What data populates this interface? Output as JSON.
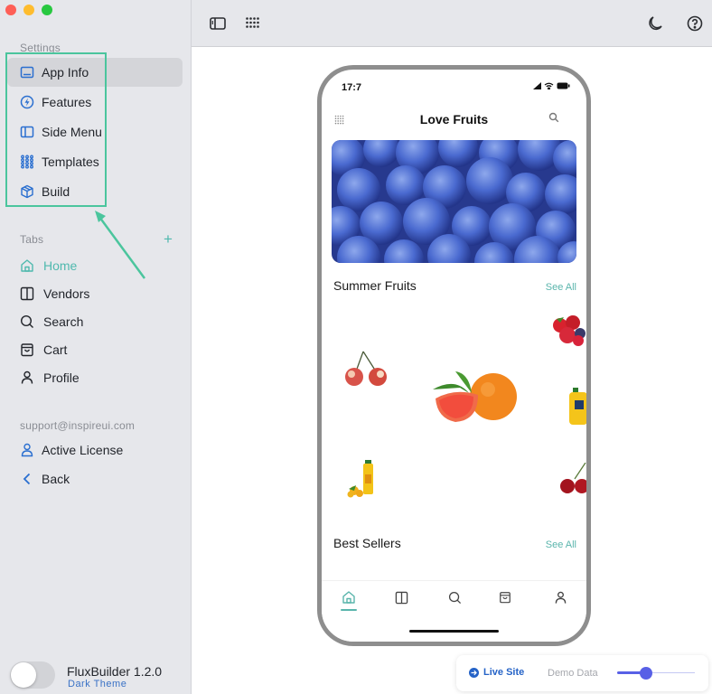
{
  "window": {
    "controls": [
      "close",
      "minimize",
      "maximize"
    ]
  },
  "sidebar": {
    "settings_label": "Settings",
    "settings_items": [
      {
        "label": "App Info",
        "icon": "app-info-icon",
        "active": true
      },
      {
        "label": "Features",
        "icon": "bolt-icon"
      },
      {
        "label": "Side Menu",
        "icon": "side-menu-icon"
      },
      {
        "label": "Templates",
        "icon": "grid-icon"
      },
      {
        "label": "Build",
        "icon": "box-icon"
      }
    ],
    "tabs_label": "Tabs",
    "add_tab_label": "+",
    "tabs": [
      {
        "label": "Home",
        "icon": "home-icon",
        "active": true
      },
      {
        "label": "Vendors",
        "icon": "columns-icon"
      },
      {
        "label": "Search",
        "icon": "search-icon"
      },
      {
        "label": "Cart",
        "icon": "cart-icon"
      },
      {
        "label": "Profile",
        "icon": "user-icon"
      }
    ],
    "support_email": "support@inspireui.com",
    "license_label": "Active License",
    "back_label": "Back",
    "app_name": "FluxBuilder 1.2.0",
    "theme_label": "Dark Theme",
    "dark_theme_on": false
  },
  "toolbar": {
    "icons": [
      "toggle-sidebar-icon",
      "apps-grid-icon",
      "moon-icon",
      "help-icon"
    ]
  },
  "phone": {
    "status_time": "17:7",
    "app_title": "Love Fruits",
    "banner_alt": "Blueberries",
    "sections": [
      {
        "title": "Summer Fruits",
        "see_all": "See All"
      },
      {
        "title": "Best Sellers",
        "see_all": "See All"
      }
    ],
    "fruits": [
      "cherries",
      "grapefruit & orange",
      "berries",
      "orange juice",
      "juice bottle",
      "red cherries"
    ],
    "bottom_nav": [
      "home",
      "vendors",
      "search",
      "cart",
      "profile"
    ],
    "active_tab": "home"
  },
  "preview": {
    "live_site_label": "Live Site",
    "demo_data_label": "Demo Data",
    "slider_value_percent": 37
  },
  "colors": {
    "accent": "#4fb9ae",
    "highlight_box": "#4bc59d",
    "link_blue": "#2563c7",
    "slider": "#5860e6"
  }
}
